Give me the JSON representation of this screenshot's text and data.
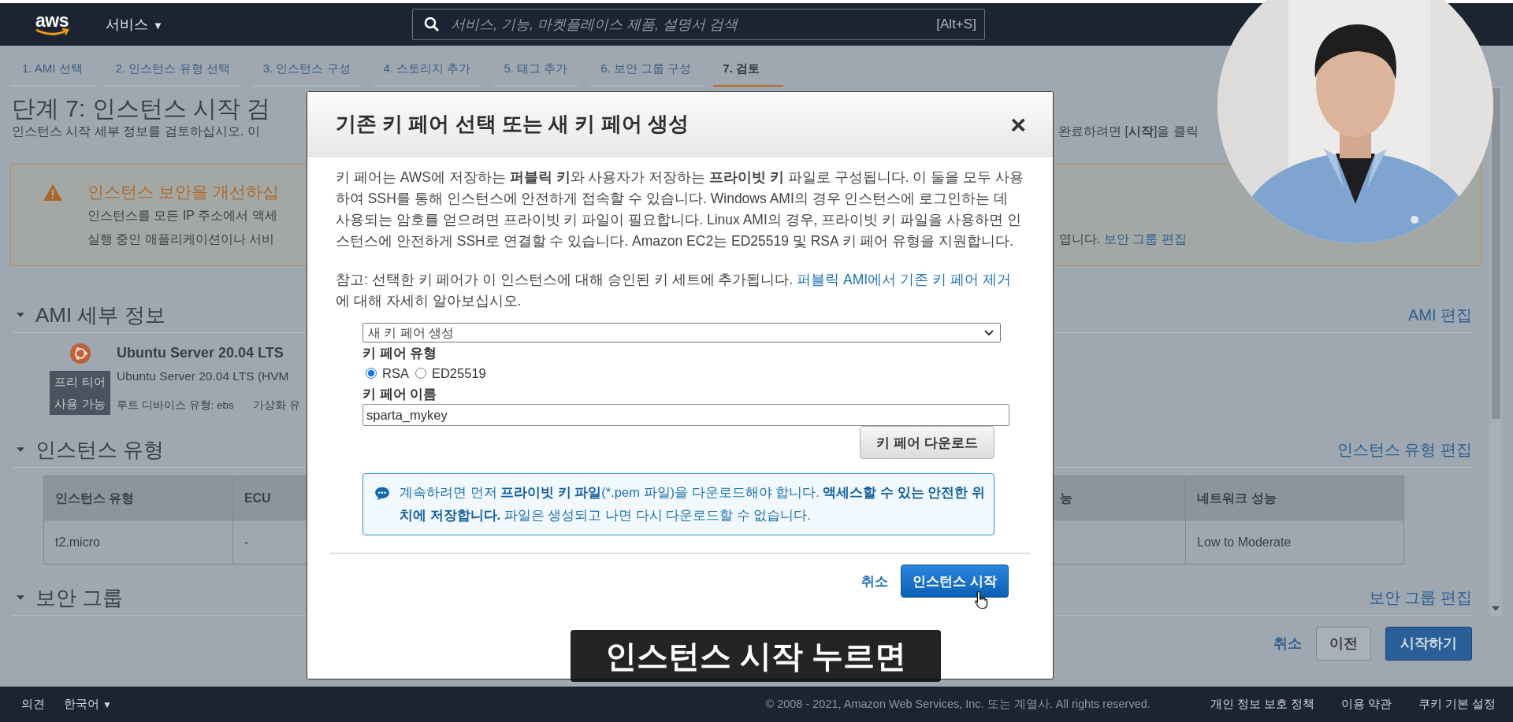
{
  "top_nav": {
    "logo": "aws",
    "services_menu": "서비스",
    "services_caret": "▼",
    "search": {
      "placeholder": "서비스, 기능, 마켓플레이스 제품, 설명서 검색",
      "shortcut": "[Alt+S]"
    }
  },
  "steps": [
    {
      "label": "1. AMI 선택",
      "selected": false
    },
    {
      "label": "2. 인스턴스 유형 선택",
      "selected": false
    },
    {
      "label": "3. 인스턴스 구성",
      "selected": false
    },
    {
      "label": "4. 스토리지 추가",
      "selected": false
    },
    {
      "label": "5. 태그 추가",
      "selected": false
    },
    {
      "label": "6. 보안 그룹 구성",
      "selected": false
    },
    {
      "label": "7. 검토",
      "selected": true
    }
  ],
  "page": {
    "title": "단계 7: 인스턴스 시작 검",
    "subtitle_left": "인스턴스 시작 세부 정보를 검토하십시오. 이",
    "subtitle_right": "완료하려면 [**시작**]을 클릭",
    "warning": {
      "title": "인스턴스 보안을 개선하십",
      "lines": [
        "인스턴스를 모든 IP 주소에서 액세",
        "실행 중인 애플리케이션이나 서비"
      ],
      "line_end": "엽니다. ",
      "link": "보안 그룹 편집"
    },
    "ami_section": {
      "heading": "AMI 세부 정보",
      "expanded": true,
      "edit_link": "AMI 편집",
      "badge_lines": [
        "프리 티어",
        "사용 가능"
      ],
      "name": "Ubuntu Server 20.04 LTS",
      "description": "Ubuntu Server 20.04 LTS (HVM",
      "root_device": "루트 디바이스 유형: ebs",
      "virtualization": "가상화 유"
    },
    "instance_section": {
      "heading": "인스턴스 유형",
      "expanded": true,
      "edit_link": "인스턴스 유형 편집",
      "table": {
        "columns": [
          "인스턴스 유형",
          "ECU",
          "능",
          "네트워크 성능"
        ],
        "rows": [
          [
            "t2.micro",
            "-",
            "",
            "Low to Moderate"
          ]
        ]
      }
    },
    "security_section": {
      "heading": "보안 그룹",
      "expanded": true,
      "edit_link": "보안 그룹 편집"
    },
    "actions": {
      "cancel": "취소",
      "previous": "이전",
      "launch": "시작하기"
    }
  },
  "modal": {
    "title": "기존 키 페어 선택 또는 새 키 페어 생성",
    "close": "×",
    "paragraph": "키 페어는 AWS에 저장하는 **퍼블릭 키**와 사용자가 저장하는 **프라이빗 키** 파일로 구성됩니다. 이 둘을 모두 사용하여 SSH를 통해 인스턴스에 안전하게 접속할 수 있습니다. Windows AMI의 경우 인스턴스에 로그인하는 데 사용되는 암호를 얻으려면 프라이빗 키 파일이 필요합니다. Linux AMI의 경우, 프라이빗 키 파일을 사용하면 인스턴스에 안전하게 SSH로 연결할 수 있습니다. Amazon EC2는 ED25519 및 RSA 키 페어 유형을 지원합니다.",
    "note": {
      "text": "참고: 선택한 키 페어가 이 인스턴스에 대해 승인된 키 세트에 추가됩니다. ",
      "link": "퍼블릭 AMI에서 기존 키 페어 제거",
      "text_after": " 에 대해 자세히 알아보십시오."
    },
    "key_pair_select": {
      "value": "새 키 페어 생성"
    },
    "key_type": {
      "label": "키 페어 유형",
      "options": [
        {
          "label": "RSA",
          "selected": true
        },
        {
          "label": "ED25519",
          "selected": false
        }
      ]
    },
    "key_name": {
      "label": "키 페어 이름",
      "value": "sparta_mykey"
    },
    "download_button": "키 페어 다운로드",
    "info": [
      {
        "text": "계속하려면 먼저 ",
        "bold": false
      },
      {
        "text": "프라이빗 키 파일",
        "bold": true
      },
      {
        "text": "(*.pem 파일)을 다운로드해야 합니다. ",
        "bold": false
      },
      {
        "text": "액세스할 수 있는 안전한 위치에 저장합니다.",
        "bold": true
      },
      {
        "text": " 파일은 생성되고 나면 다시 다운로드할 수 없습니다.",
        "bold": false
      }
    ],
    "cancel": "취소",
    "launch": "인스턴스 시작"
  },
  "caption": "인스턴스 시작 누르면",
  "footer": {
    "feedback": "의견",
    "language": "한국어",
    "language_caret": "▼",
    "copyright": "© 2008 - 2021, Amazon Web Services, Inc. 또는 계열사. All rights reserved.",
    "links": [
      "개인 정보 보호 정책",
      "이용 약관",
      "쿠키 기본 설정"
    ]
  }
}
